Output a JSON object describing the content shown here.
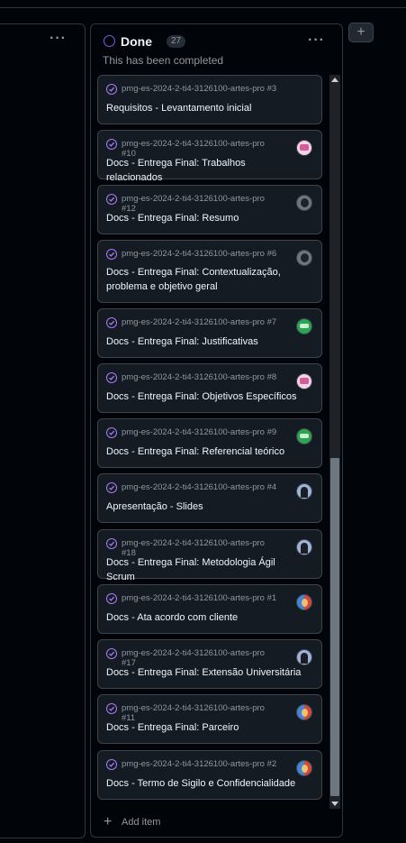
{
  "left_column": {
    "more_label": "···"
  },
  "done_column": {
    "title": "Done",
    "count": "27",
    "description": "This has been completed",
    "more_label": "···",
    "add_item_label": "Add item",
    "status_color": "#8957e5"
  },
  "add_column_label": "+",
  "cards": [
    {
      "ref": "pmg-es-2024-2-ti4-3126100-artes-pro #3",
      "title": "Requisitos - Levantamento inicial",
      "avatar": "none"
    },
    {
      "ref": "pmg-es-2024-2-ti4-3126100-artes-pro #10",
      "title": "Docs - Entrega Final: Trabalhos relacionados",
      "avatar": "pink"
    },
    {
      "ref": "pmg-es-2024-2-ti4-3126100-artes-pro #12",
      "title": "Docs - Entrega Final: Resumo",
      "avatar": "dark"
    },
    {
      "ref": "pmg-es-2024-2-ti4-3126100-artes-pro #6",
      "title": "Docs - Entrega Final: Contextualização, problema e objetivo geral",
      "avatar": "dark"
    },
    {
      "ref": "pmg-es-2024-2-ti4-3126100-artes-pro #7",
      "title": "Docs - Entrega Final: Justificativas",
      "avatar": "green"
    },
    {
      "ref": "pmg-es-2024-2-ti4-3126100-artes-pro #8",
      "title": "Docs - Entrega Final: Objetivos Específicos",
      "avatar": "pink"
    },
    {
      "ref": "pmg-es-2024-2-ti4-3126100-artes-pro #9",
      "title": "Docs - Entrega Final: Referencial teórico",
      "avatar": "green"
    },
    {
      "ref": "pmg-es-2024-2-ti4-3126100-artes-pro #4",
      "title": "Apresentação - Slides",
      "avatar": "girl"
    },
    {
      "ref": "pmg-es-2024-2-ti4-3126100-artes-pro #18",
      "title": "Docs - Entrega Final: Metodologia Ágil Scrum",
      "avatar": "girl"
    },
    {
      "ref": "pmg-es-2024-2-ti4-3126100-artes-pro #1",
      "title": "Docs - Ata acordo com cliente",
      "avatar": "color"
    },
    {
      "ref": "pmg-es-2024-2-ti4-3126100-artes-pro #17",
      "title": "Docs - Entrega Final: Extensão Universitária",
      "avatar": "girl"
    },
    {
      "ref": "pmg-es-2024-2-ti4-3126100-artes-pro #11",
      "title": "Docs - Entrega Final: Parceiro",
      "avatar": "color"
    },
    {
      "ref": "pmg-es-2024-2-ti4-3126100-artes-pro #2",
      "title": "Docs - Termo de Sigilo e Confidencialidade",
      "avatar": "color"
    }
  ]
}
